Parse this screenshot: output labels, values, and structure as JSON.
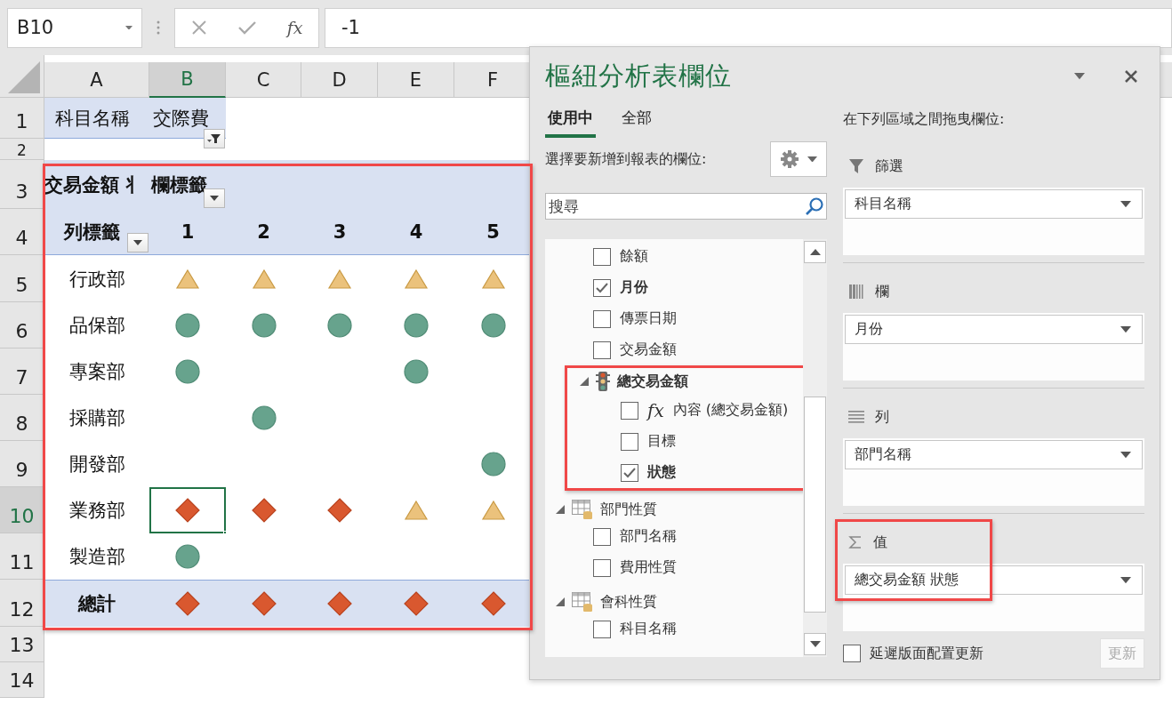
{
  "name_box": {
    "value": "B10"
  },
  "formula_bar": {
    "fx": "fx",
    "value": "-1"
  },
  "columns": [
    {
      "label": "A",
      "selected": false
    },
    {
      "label": "B",
      "selected": true
    },
    {
      "label": "C",
      "selected": false
    },
    {
      "label": "D",
      "selected": false
    },
    {
      "label": "E",
      "selected": false
    },
    {
      "label": "F",
      "selected": false
    }
  ],
  "rows": [
    {
      "label": "1",
      "selected": false
    },
    {
      "label": "2",
      "selected": false
    },
    {
      "label": "3",
      "selected": false
    },
    {
      "label": "4",
      "selected": false
    },
    {
      "label": "5",
      "selected": false
    },
    {
      "label": "6",
      "selected": false
    },
    {
      "label": "7",
      "selected": false
    },
    {
      "label": "8",
      "selected": false
    },
    {
      "label": "9",
      "selected": false
    },
    {
      "label": "10",
      "selected": true
    },
    {
      "label": "11",
      "selected": false
    },
    {
      "label": "12",
      "selected": false
    },
    {
      "label": "13",
      "selected": false
    },
    {
      "label": "14",
      "selected": false
    }
  ],
  "pivot": {
    "filter": {
      "field": "科目名稱",
      "value": "交際費"
    },
    "column_header": "交易金額 丬 欄標籤",
    "row_header": "列標籤",
    "months": [
      "1",
      "2",
      "3",
      "4",
      "5"
    ],
    "rows": [
      {
        "label": "行政部",
        "marks": [
          {
            "kind": "triangle"
          },
          {
            "kind": "triangle"
          },
          {
            "kind": "triangle"
          },
          {
            "kind": "triangle"
          },
          {
            "kind": "triangle"
          }
        ]
      },
      {
        "label": "品保部",
        "marks": [
          {
            "kind": "circle"
          },
          {
            "kind": "circle"
          },
          {
            "kind": "circle"
          },
          {
            "kind": "circle"
          },
          {
            "kind": "circle"
          }
        ]
      },
      {
        "label": "專案部",
        "marks": [
          {
            "kind": "circle"
          },
          {
            "kind": "none"
          },
          {
            "kind": "none"
          },
          {
            "kind": "circle"
          },
          {
            "kind": "none"
          }
        ]
      },
      {
        "label": "採購部",
        "marks": [
          {
            "kind": "none"
          },
          {
            "kind": "circle"
          },
          {
            "kind": "none"
          },
          {
            "kind": "none"
          },
          {
            "kind": "none"
          }
        ]
      },
      {
        "label": "開發部",
        "marks": [
          {
            "kind": "none"
          },
          {
            "kind": "none"
          },
          {
            "kind": "none"
          },
          {
            "kind": "none"
          },
          {
            "kind": "circle"
          }
        ]
      },
      {
        "label": "業務部",
        "marks": [
          {
            "kind": "diamond"
          },
          {
            "kind": "diamond"
          },
          {
            "kind": "diamond"
          },
          {
            "kind": "triangle"
          },
          {
            "kind": "triangle"
          }
        ]
      },
      {
        "label": "製造部",
        "marks": [
          {
            "kind": "circle"
          },
          {
            "kind": "none"
          },
          {
            "kind": "none"
          },
          {
            "kind": "none"
          },
          {
            "kind": "none"
          }
        ]
      }
    ],
    "total": {
      "label": "總計",
      "marks": [
        {
          "kind": "diamond"
        },
        {
          "kind": "diamond"
        },
        {
          "kind": "diamond"
        },
        {
          "kind": "diamond"
        },
        {
          "kind": "diamond"
        }
      ]
    }
  },
  "field_pane": {
    "title": "樞紐分析表欄位",
    "tabs": [
      {
        "label": "使用中",
        "selected": true
      },
      {
        "label": "全部",
        "selected": false
      }
    ],
    "prompt": "選擇要新增到報表的欄位:",
    "search": {
      "placeholder": "搜尋"
    },
    "fields": [
      {
        "kind": "field",
        "label": "餘額",
        "checked": false
      },
      {
        "kind": "field",
        "label": "月份",
        "checked": true
      },
      {
        "kind": "field",
        "label": "傳票日期",
        "checked": false
      },
      {
        "kind": "field",
        "label": "交易金額",
        "checked": false
      },
      {
        "kind": "kpi",
        "label": "總交易金額",
        "expanded": true,
        "children": [
          {
            "kind": "formula",
            "prefix": "fx",
            "label": "內容 (總交易金額)",
            "checked": false
          },
          {
            "kind": "field",
            "label": "目標",
            "checked": false
          },
          {
            "kind": "field",
            "label": "狀態",
            "checked": true
          }
        ]
      },
      {
        "kind": "table",
        "label": "部門性質",
        "expanded": true,
        "children": [
          {
            "kind": "field",
            "label": "部門名稱",
            "checked": false
          },
          {
            "kind": "field",
            "label": "費用性質",
            "checked": false
          }
        ]
      },
      {
        "kind": "table",
        "label": "會科性質",
        "expanded": true,
        "children": [
          {
            "kind": "field",
            "label": "科目名稱",
            "checked": false
          }
        ]
      }
    ],
    "areas_hint": "在下列區域之間拖曳欄位:",
    "areas": [
      {
        "kind": "filter",
        "label": "篩選",
        "items": [
          "科目名稱"
        ]
      },
      {
        "kind": "columns",
        "label": "欄",
        "items": [
          "月份"
        ]
      },
      {
        "kind": "rows",
        "label": "列",
        "items": [
          "部門名稱"
        ]
      },
      {
        "kind": "values",
        "label": "值",
        "items": [
          "總交易金額 狀態"
        ]
      }
    ],
    "defer": {
      "label": "延遲版面配置更新",
      "checked": false
    },
    "update_button": {
      "label": "更新",
      "disabled": true
    }
  }
}
